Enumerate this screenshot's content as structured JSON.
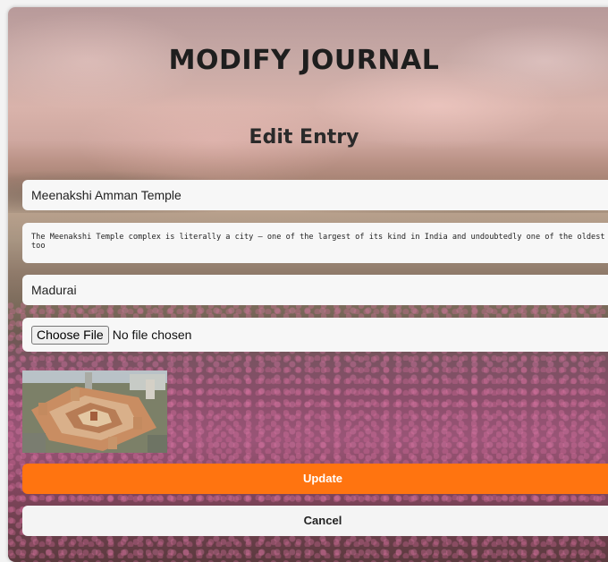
{
  "page": {
    "title": "MODIFY JOURNAL",
    "subtitle": "Edit Entry"
  },
  "form": {
    "name_value": "Meenakshi Amman Temple",
    "description_value": "The Meenakshi Temple complex is literally a city – one of the largest of its kind in India and undoubtedly one of the oldest too",
    "location_value": "Madurai",
    "file_button_label": "Choose File",
    "file_status": "No file chosen",
    "update_label": "Update",
    "cancel_label": "Cancel"
  },
  "colors": {
    "update_button": "#ff7410",
    "cancel_button": "#f4f4f4",
    "field_background": "#f7f7f7"
  }
}
